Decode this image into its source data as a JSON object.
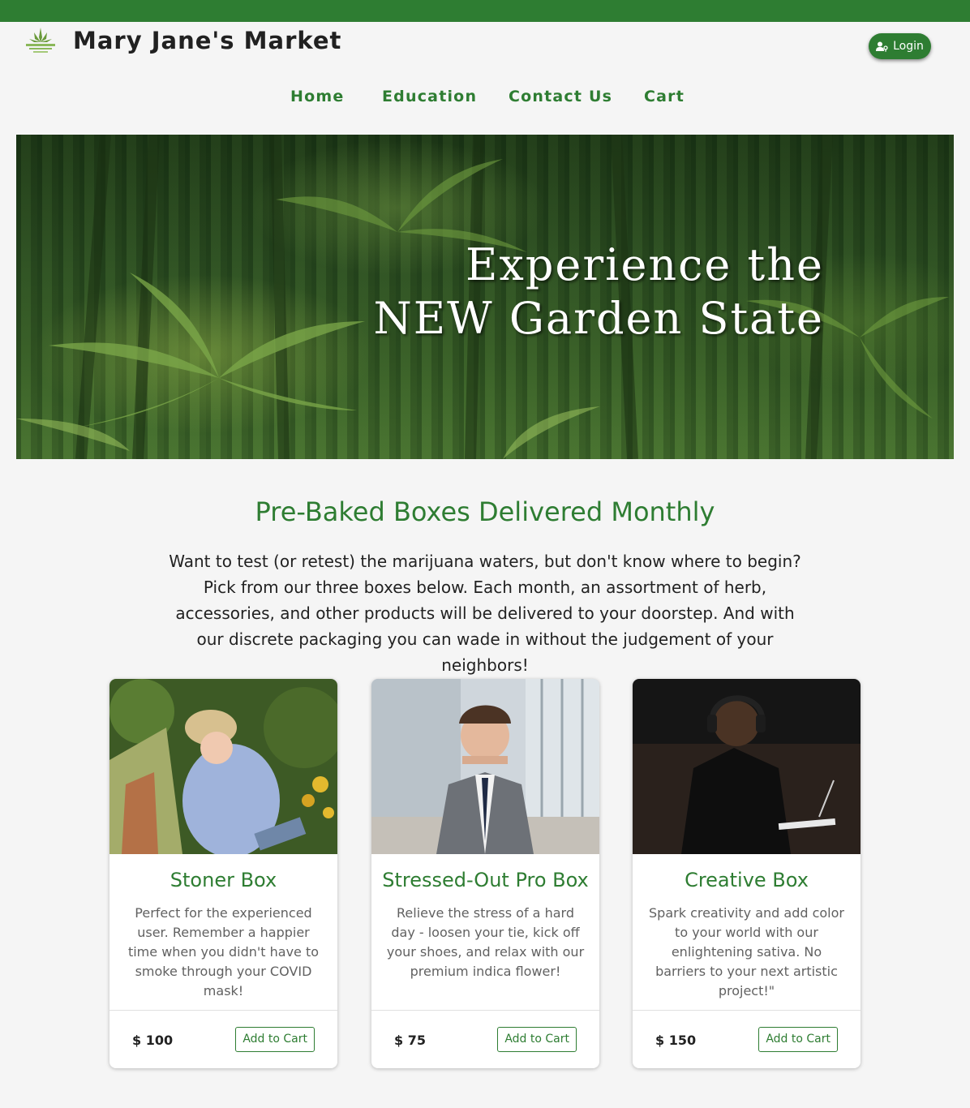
{
  "header": {
    "site_title": "Mary Jane's Market",
    "login_label": "Login"
  },
  "nav": {
    "items": [
      {
        "label": "Home"
      },
      {
        "label": "Education"
      },
      {
        "label": "Contact Us"
      },
      {
        "label": "Cart"
      }
    ]
  },
  "hero": {
    "line1": "Experience the",
    "line2": "NEW Garden State"
  },
  "boxes_section": {
    "title": "Pre-Baked Boxes Delivered Monthly",
    "intro": "Want to test (or retest) the marijuana waters, but don't know where to begin? Pick from our three boxes below. Each month, an assortment of herb, accessories, and other products will be delivered to your doorstep. And with our discrete packaging you can wade in without the judgement of your neighbors!"
  },
  "products": [
    {
      "title": "Stoner Box",
      "description": "Perfect for the experienced user. Remember a happier time when you didn't have to smoke through your COVID mask!",
      "price": "$ 100",
      "button_label": "Add to Cart"
    },
    {
      "title": "Stressed-Out Pro Box",
      "description": "Relieve the stress of a hard day - loosen your tie, kick off your shoes, and relax with our premium indica flower!",
      "price": "$ 75",
      "button_label": "Add to Cart"
    },
    {
      "title": "Creative Box",
      "description": "Spark creativity and add color to your world with our enlightening sativa. No barriers to your next artistic project!\"",
      "price": "$ 150",
      "button_label": "Add to Cart"
    }
  ],
  "colors": {
    "brand_green": "#2e7d32",
    "background": "#f5f5f5"
  }
}
